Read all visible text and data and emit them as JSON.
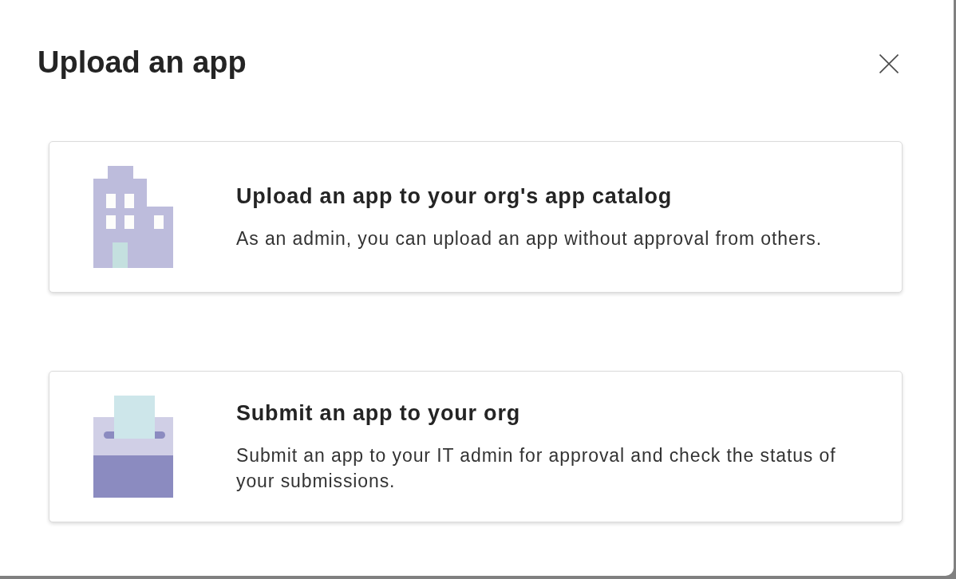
{
  "dialog": {
    "title": "Upload an app"
  },
  "options": [
    {
      "kind": "catalog",
      "title": "Upload an app to your org's app catalog",
      "description": "As an admin, you can upload an app without approval from others."
    },
    {
      "kind": "submit",
      "title": "Submit an app to your org",
      "description": "Submit an app to your IT admin for approval and check the status of your submissions."
    }
  ]
}
